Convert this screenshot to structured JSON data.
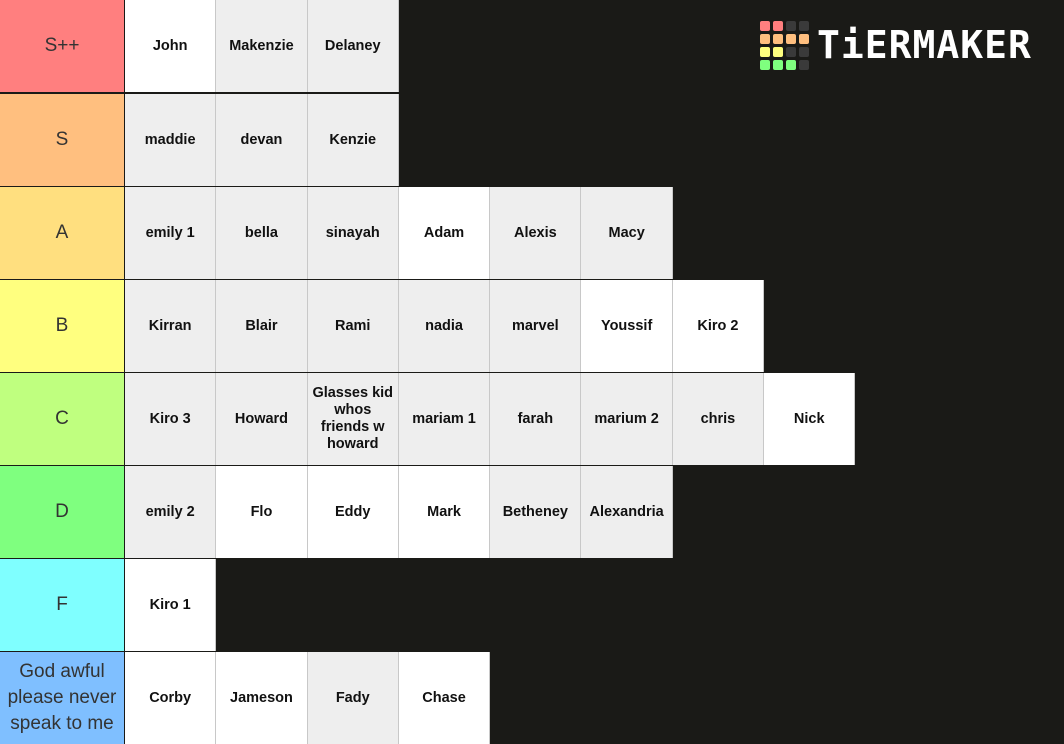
{
  "app": {
    "brand": "TiERMAKER"
  },
  "logo": {
    "grid_colors": [
      [
        "#ff7f7f",
        "#ff7f7f",
        "#3a3a3a",
        "#3a3a3a"
      ],
      [
        "#ffbf7f",
        "#ffbf7f",
        "#ffbf7f",
        "#ffbf7f"
      ],
      [
        "#ffff7f",
        "#ffff7f",
        "#3a3a3a",
        "#3a3a3a"
      ],
      [
        "#7fff7f",
        "#7fff7f",
        "#7fff7f",
        "#3a3a3a"
      ]
    ]
  },
  "tiers": [
    {
      "label": "S++",
      "color": "#ff7f7f",
      "items": [
        {
          "name": "John",
          "bg": "w"
        },
        {
          "name": "Makenzie",
          "bg": "g"
        },
        {
          "name": "Delaney",
          "bg": "g"
        }
      ]
    },
    {
      "label": "S",
      "color": "#ffbf7f",
      "items": [
        {
          "name": "maddie",
          "bg": "g"
        },
        {
          "name": "devan",
          "bg": "g"
        },
        {
          "name": "Kenzie",
          "bg": "g"
        }
      ]
    },
    {
      "label": "A",
      "color": "#ffdf7f",
      "items": [
        {
          "name": "emily 1",
          "bg": "g"
        },
        {
          "name": "bella",
          "bg": "g"
        },
        {
          "name": "sinayah",
          "bg": "g"
        },
        {
          "name": "Adam",
          "bg": "w"
        },
        {
          "name": "Alexis",
          "bg": "g"
        },
        {
          "name": "Macy",
          "bg": "g"
        }
      ]
    },
    {
      "label": "B",
      "color": "#ffff7f",
      "items": [
        {
          "name": "Kirran",
          "bg": "g"
        },
        {
          "name": "Blair",
          "bg": "g"
        },
        {
          "name": "Rami",
          "bg": "g"
        },
        {
          "name": "nadia",
          "bg": "g"
        },
        {
          "name": "marvel",
          "bg": "g"
        },
        {
          "name": "Youssif",
          "bg": "w"
        },
        {
          "name": "Kiro 2",
          "bg": "w"
        }
      ]
    },
    {
      "label": "C",
      "color": "#bfff7f",
      "items": [
        {
          "name": "Kiro 3",
          "bg": "g"
        },
        {
          "name": "Howard",
          "bg": "g"
        },
        {
          "name": "Glasses kid whos friends w howard",
          "bg": "g"
        },
        {
          "name": "mariam 1",
          "bg": "g"
        },
        {
          "name": "farah",
          "bg": "g"
        },
        {
          "name": "marium 2",
          "bg": "g"
        },
        {
          "name": "chris",
          "bg": "g"
        },
        {
          "name": "Nick",
          "bg": "w"
        }
      ]
    },
    {
      "label": "D",
      "color": "#7fff7f",
      "items": [
        {
          "name": "emily 2",
          "bg": "g"
        },
        {
          "name": "Flo",
          "bg": "w"
        },
        {
          "name": "Eddy",
          "bg": "w"
        },
        {
          "name": "Mark",
          "bg": "w"
        },
        {
          "name": "Betheney",
          "bg": "g"
        },
        {
          "name": "Alexandria",
          "bg": "g"
        }
      ]
    },
    {
      "label": "F",
      "color": "#7fffff",
      "items": [
        {
          "name": "Kiro 1",
          "bg": "w"
        }
      ]
    },
    {
      "label": "God awful please never speak to me",
      "color": "#7fbfff",
      "items": [
        {
          "name": "Corby",
          "bg": "w"
        },
        {
          "name": "Jameson",
          "bg": "w"
        },
        {
          "name": "Fady",
          "bg": "g"
        },
        {
          "name": "Chase",
          "bg": "w"
        }
      ]
    }
  ]
}
